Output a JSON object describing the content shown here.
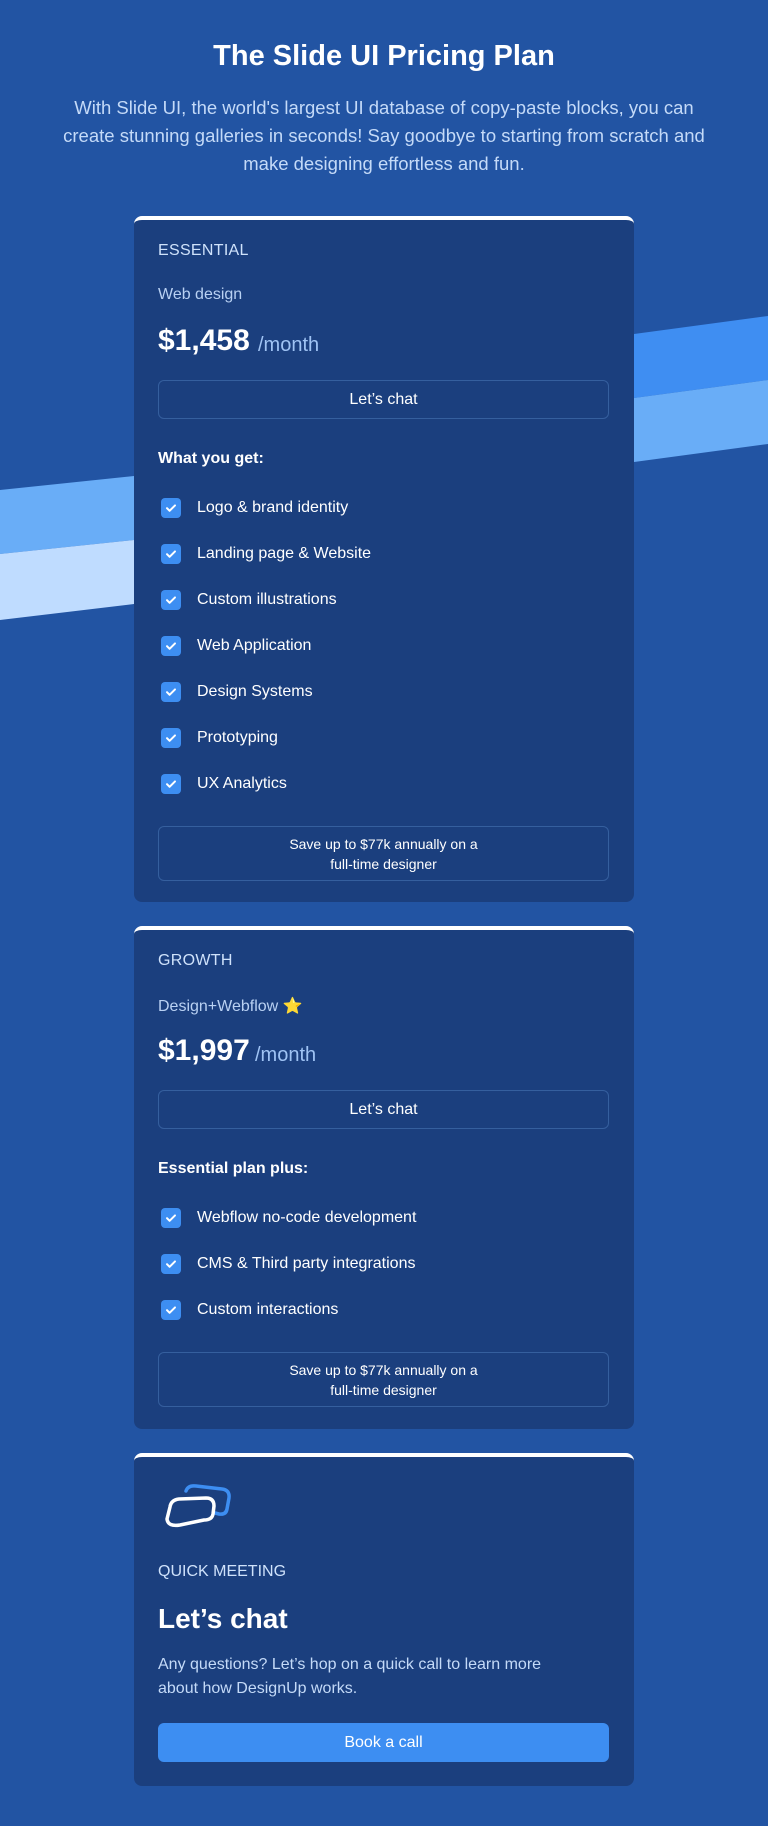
{
  "header": {
    "title": "The Slide UI Pricing Plan",
    "subtitle": "With Slide UI, the world's largest UI database of copy-paste blocks, you can create stunning galleries in seconds! Say goodbye to starting from scratch and make designing effortless and fun."
  },
  "plans": [
    {
      "name": "ESSENTIAL",
      "subtitle": "Web design",
      "price": "$1,458",
      "period": "/month",
      "cta": "Let’s chat",
      "features_title": "What you get:",
      "features": [
        "Logo & brand identity",
        "Landing page & Website",
        "Custom illustrations",
        "Web Application",
        "Design Systems",
        "Prototyping",
        "UX Analytics"
      ],
      "savings": "Save up to $77k annually on a full-time designer"
    },
    {
      "name": "GROWTH",
      "subtitle": "Design+Webflow ⭐",
      "price": "$1,997",
      "period": "/month",
      "cta": "Let’s chat",
      "features_title": "Essential plan plus:",
      "features": [
        "Webflow no-code development",
        "CMS & Third party integrations",
        "Custom interactions"
      ],
      "savings": "Save up to $77k annually on a full-time designer"
    }
  ],
  "meeting": {
    "icon": "chat-bubbles-icon",
    "label": "QUICK MEETING",
    "title": "Let’s chat",
    "description": "Any questions? Let’s hop on a quick call to learn more about how DesignUp works.",
    "cta": "Book a call"
  },
  "colors": {
    "background": "#2254a3",
    "card": "#1b3f7e",
    "accent": "#3d8ef2",
    "stripe_light": "#bfdcff",
    "stripe_mid": "#69adf7",
    "stripe_dark": "#3f8ef2"
  }
}
